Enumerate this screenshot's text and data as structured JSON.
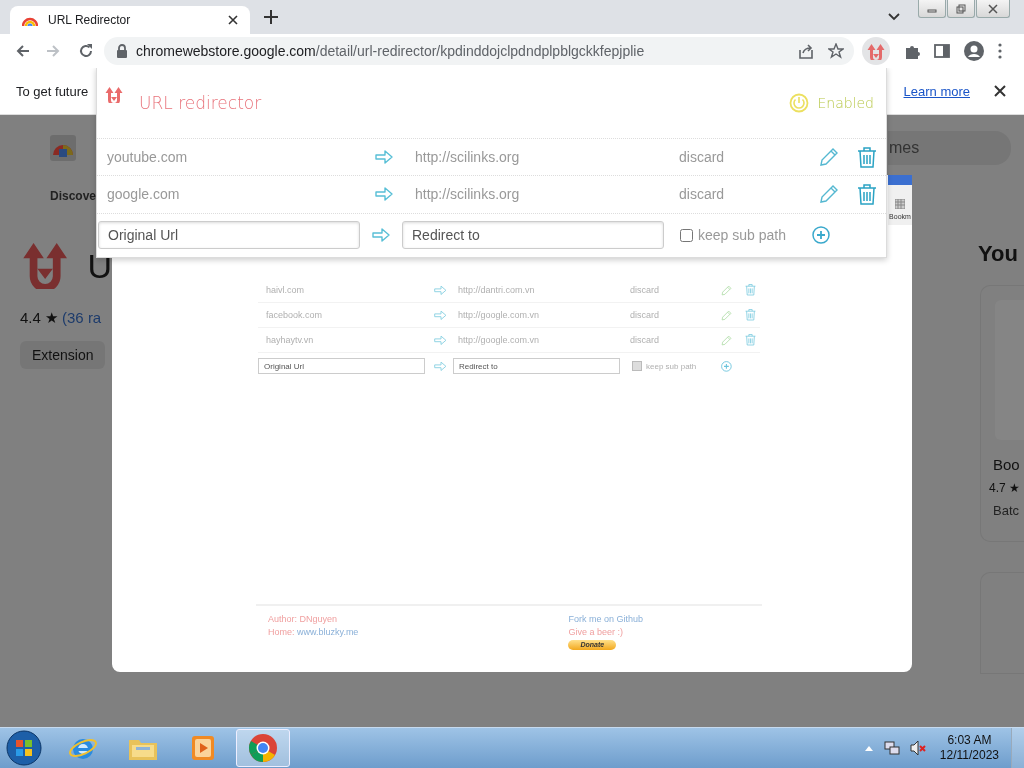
{
  "browser": {
    "tab": {
      "title": "URL Redirector"
    },
    "address": {
      "host": "chromewebstore.google.com",
      "path": "/detail/url-redirector/kpdinddojclpdndplpblgckkfepjplie"
    }
  },
  "infobar": {
    "text": "To get future",
    "link": "Learn more"
  },
  "store_page": {
    "discover": "Discove",
    "title": "U",
    "rating": "4.4 ★",
    "ratings_link": "(36 ra",
    "chip": "Extension",
    "search": "mes",
    "section_title": "You",
    "card": {
      "title": "Boo",
      "rating": "4.7 ★",
      "subtitle": "Batc"
    }
  },
  "screenshot": {
    "toolbar_label": "Bookm",
    "rules": [
      {
        "from": "haivl.com",
        "to": "http://dantri.com.vn",
        "action": "discard"
      },
      {
        "from": "facebook.com",
        "to": "http://google.com.vn",
        "action": "discard"
      },
      {
        "from": "hayhaytv.vn",
        "to": "http://google.com.vn",
        "action": "discard"
      }
    ],
    "new_rule": {
      "from_placeholder": "Original Url",
      "to_placeholder": "Redirect to",
      "keep_sub_path": "keep sub path"
    },
    "footer": {
      "author_label": "Author:",
      "author": "DNguyen",
      "home_label": "Home:",
      "home": "www.bluzky.me",
      "github": "Fork me on Github",
      "beer": "Give a beer :)",
      "donate": "Donate"
    }
  },
  "popup": {
    "title": "URL redirector",
    "status": {
      "label": "Enabled",
      "on": true
    },
    "rules": [
      {
        "from": "youtube.com",
        "to": "http://scilinks.org",
        "action": "discard"
      },
      {
        "from": "google.com",
        "to": "http://scilinks.org",
        "action": "discard"
      }
    ],
    "new_rule": {
      "from_placeholder": "Original Url",
      "to_placeholder": "Redirect to",
      "keep_sub_path": {
        "label": "keep sub path",
        "checked": false
      }
    }
  },
  "taskbar": {
    "apps": [
      {
        "kind": "ie",
        "selected": false
      },
      {
        "kind": "explorer",
        "selected": false
      },
      {
        "kind": "media",
        "selected": false
      },
      {
        "kind": "chrome",
        "selected": true
      }
    ],
    "clock": {
      "time": "6:03 AM",
      "date": "12/11/2023"
    }
  }
}
